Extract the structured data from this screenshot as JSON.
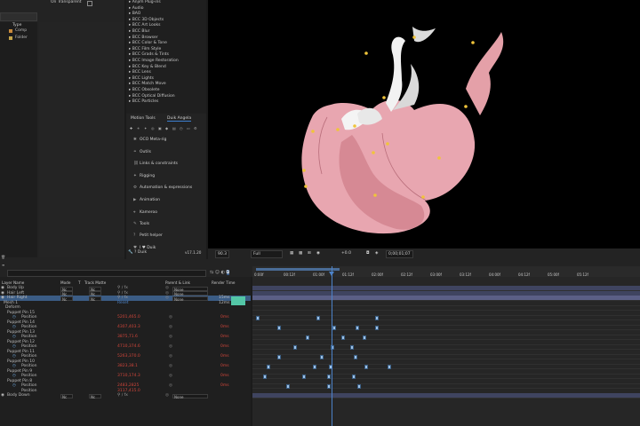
{
  "project": {
    "col_type": "Type",
    "rows": [
      {
        "name": "Comp",
        "color": "#c98a3c"
      },
      {
        "name": "Folder",
        "color": "#c7a64a"
      }
    ]
  },
  "effects": {
    "on_transparent": "On Transparent",
    "items": [
      "Anjim Plug-ins",
      "Audio",
      "BAO",
      "BCC 3D Objects",
      "BCC Art Looks",
      "BCC Blur",
      "BCC Browser",
      "BCC Color & Tone",
      "BCC Film Style",
      "BCC Grads & Tints",
      "BCC Image Restoration",
      "BCC Key & Blend",
      "BCC Lens",
      "BCC Lights",
      "BCC Match Move",
      "BCC Obsolete",
      "BCC Optical Diffusion",
      "BCC Particles"
    ]
  },
  "duik": {
    "tab1": "Motion Tools",
    "tab2": "Duik Angela",
    "items": [
      {
        "icon": "✱",
        "label": "OCO Meta-rig"
      },
      {
        "icon": "⚭",
        "label": "Outils"
      },
      {
        "icon": "⛓",
        "label": "Links & constraints"
      },
      {
        "icon": "✦",
        "label": "Rigging"
      },
      {
        "icon": "⚙",
        "label": "Automation & expressions"
      },
      {
        "icon": "▶",
        "label": "Animation"
      },
      {
        "icon": "⌖",
        "label": "Kameroo"
      },
      {
        "icon": "✎",
        "label": "Tools"
      },
      {
        "icon": "?",
        "label": "Petit helper"
      },
      {
        "icon": "♥",
        "label": "I ♥ Duik"
      }
    ],
    "footer_name": "Duik",
    "version": "v17.1.20"
  },
  "viewer": {
    "zoom": "90.3",
    "resolution": "Full",
    "exposure": "+0.0",
    "timecode": "0;00;01;07"
  },
  "timeline": {
    "headers": {
      "name": "Layer Name",
      "mode": "Mode",
      "t": "T",
      "trkmat": "Track Matte",
      "parent": "Parent & Link",
      "render": "Render Time"
    },
    "ticks": [
      "0:00f",
      "00:12f",
      "01:00f",
      "01:12f",
      "02:00f",
      "02:12f",
      "03:00f",
      "03:12f",
      "04:00f",
      "04:12f",
      "05:00f",
      "05:12f"
    ],
    "layers": [
      {
        "name": "Body Up",
        "mode": "Nc",
        "trkmat": "Nc",
        "parent": "None"
      },
      {
        "name": "Hair Left",
        "mode": "Nc",
        "trkmat": "Nc",
        "parent": "None"
      },
      {
        "name": "Hair Right",
        "mode": "Nc",
        "trkmat": "Nc",
        "parent": "None",
        "render": "15ms",
        "selected": true
      }
    ],
    "mesh_row": {
      "name": "Mesh 1",
      "render": "12ms"
    },
    "reset_label": "Reset",
    "deform_label": "Deform",
    "pins": [
      {
        "name": "Puppet Pin 15",
        "value": "5201,465.0"
      },
      {
        "name": "Puppet Pin 14",
        "value": "4307,403.3"
      },
      {
        "name": "Puppet Pin 13",
        "value": "3875,71.6"
      },
      {
        "name": "Puppet Pin 12",
        "value": "4710,374.6"
      },
      {
        "name": "Puppet Pin 11",
        "value": "5263,370.0"
      },
      {
        "name": "Puppet Pin 10",
        "value": "3823,38.1"
      },
      {
        "name": "Puppet Pin 9",
        "value": "3710,174.3"
      },
      {
        "name": "Puppet Pin 8",
        "value": "2483,2825"
      }
    ],
    "position_label": "Position",
    "ms_label": "0ms",
    "last_layers": [
      {
        "name": "Position",
        "value": "3117,415.0"
      },
      {
        "name": "Body Down",
        "mode": "Nc",
        "trkmat": "Nc",
        "parent": "None"
      }
    ]
  },
  "colors": {
    "selected_row": "#3b5c85",
    "keyframe": "#9fc2e6",
    "render_bar": "#53c6a6",
    "accent_blue": "#4d83c9"
  }
}
